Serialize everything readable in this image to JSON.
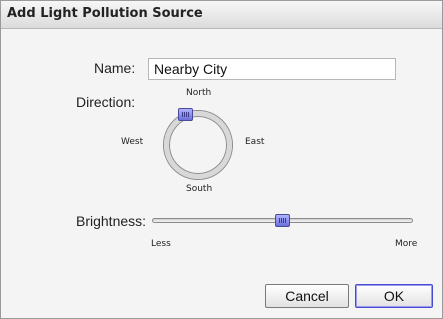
{
  "dialog": {
    "title": "Add Light Pollution Source",
    "name_label": "Name:",
    "name_value": "Nearby City",
    "direction_label": "Direction:",
    "directions": {
      "north": "North",
      "south": "South",
      "east": "East",
      "west": "West"
    },
    "brightness_label": "Brightness:",
    "brightness_min_label": "Less",
    "brightness_max_label": "More",
    "brightness_level_fraction": 0.5,
    "direction_heading": "North",
    "buttons": {
      "cancel": "Cancel",
      "ok": "OK"
    }
  },
  "colors": {
    "knob": "#8a8ee8",
    "default_button_border": "#4a4ad0"
  }
}
